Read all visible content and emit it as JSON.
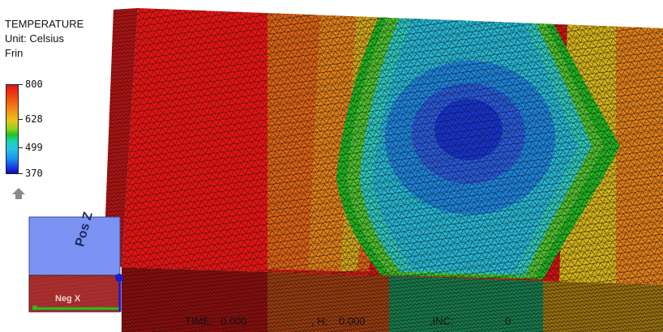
{
  "legend": {
    "title": "TEMPERATURE",
    "unit": "Unit: Celsius",
    "subtitle": "Frin",
    "ticks": [
      "800",
      "628",
      "499",
      "370"
    ]
  },
  "status": {
    "time_label": "TIME:",
    "time_value": "0.000",
    "h_label": ", H:",
    "h_value": "0.000",
    "inc_label": ",INC:",
    "inc_value": "0"
  },
  "view_cube": {
    "top_face": "Pos Z",
    "front_face": "Neg X"
  },
  "icons": {
    "up_arrow": "up-arrow-icon",
    "view_cube": "view-cube-icon"
  },
  "colors": {
    "red": "#e31313",
    "orange": "#f58a18",
    "yellow": "#e8c31a",
    "green": "#22c322",
    "cyan": "#27c6e6",
    "blue": "#1736e6",
    "view_cube_top": "#7b93f2",
    "view_cube_front": "#b23030"
  }
}
